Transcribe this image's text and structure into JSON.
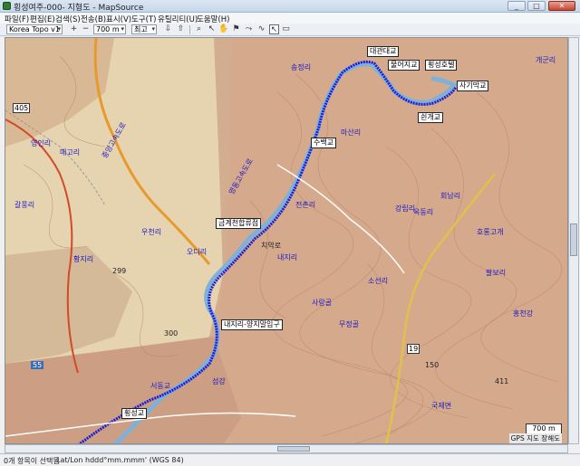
{
  "window": {
    "title": "횡성여주-000- 지형도 - MapSource",
    "minimize": "_",
    "maximize": "□",
    "close": "✕"
  },
  "menu": {
    "items": [
      "파일(F)",
      "편집(E)",
      "검색(S)",
      "전송(B)",
      "표시(V)",
      "도구(T)",
      "유틸리티(U)",
      "도움말(H)"
    ]
  },
  "toolbar": {
    "map_product": "Korea Topo v1",
    "zoom_level": "700 m",
    "detail_level": "최고",
    "zoom_in": "+",
    "zoom_out": "−"
  },
  "map": {
    "poi_boxes": [
      {
        "label": "대관대교"
      },
      {
        "label": "횡성호텔"
      },
      {
        "label": "물어지교"
      },
      {
        "label": "사기막교"
      },
      {
        "label": "쉰개교"
      },
      {
        "label": "수백교"
      },
      {
        "label": "금계천합류점"
      },
      {
        "label": "내지리-양지말입구"
      },
      {
        "label": "횡성교"
      }
    ],
    "road_numbers": [
      "405",
      "19",
      "55",
      "150",
      "300",
      "299",
      "411"
    ],
    "place_labels": [
      "매고리",
      "영인리",
      "우천리",
      "갈풍리",
      "황지리",
      "오디리",
      "섬강",
      "치악로",
      "송정리",
      "마산리",
      "옥동리",
      "호롱고개",
      "회남리",
      "강립리",
      "소선리",
      "사랑골",
      "내지리",
      "전촌리",
      "무정골",
      "국제면",
      "홍천강",
      "팔보리",
      "개군리",
      "서동교"
    ],
    "highway_labels": [
      "중앙고속도로",
      "영동고속도로"
    ],
    "scale": "700 m",
    "gps_datum": "GPS 지도 장해도"
  },
  "status": {
    "selection": "0개 항목이 선택됨",
    "coords": "Lat/Lon hddd°mm.mmm' (WGS 84)"
  }
}
